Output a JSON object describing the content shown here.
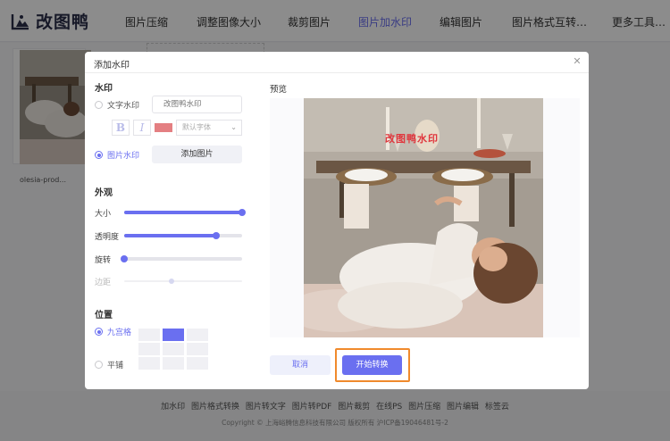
{
  "brand": {
    "name": "改图鸭"
  },
  "nav": {
    "items": [
      {
        "label": "图片压缩"
      },
      {
        "label": "调整图像大小"
      },
      {
        "label": "裁剪图片"
      },
      {
        "label": "图片加水印",
        "active": true
      },
      {
        "label": "编辑图片"
      },
      {
        "label": "图片格式互转…"
      },
      {
        "label": "更多工具…"
      }
    ]
  },
  "file": {
    "name": "olesia-prod..."
  },
  "footer": {
    "links": [
      "加水印",
      "图片格式转换",
      "图片转文字",
      "图片转PDF",
      "图片裁剪",
      "在线PS",
      "图片压缩",
      "图片编辑",
      "标签云"
    ],
    "copyright": "Copyright © 上海峪腾信息科技有限公司 版权所有 沪ICP备19046481号-2"
  },
  "modal": {
    "title": "添加水印",
    "watermark_section": {
      "title": "水印",
      "text_option": "文字水印",
      "text_placeholder": "改图鸭水印",
      "bold_label": "B",
      "italic_label": "I",
      "font_select": "默认字体",
      "image_option": "图片水印",
      "add_image_button": "添加图片",
      "selected": "image"
    },
    "appearance": {
      "title": "外观",
      "sliders": [
        {
          "label": "大小",
          "value": 100,
          "enabled": true
        },
        {
          "label": "透明度",
          "value": 78,
          "enabled": true
        },
        {
          "label": "旋转",
          "value": 0,
          "enabled": true
        },
        {
          "label": "边距",
          "value": 40,
          "enabled": false
        }
      ]
    },
    "position": {
      "title": "位置",
      "grid_option": "九宫格",
      "tile_option": "平铺",
      "selected": "grid",
      "selected_cell": 1
    },
    "preview": {
      "label": "预览",
      "watermark_text": "改图鸭水印"
    },
    "buttons": {
      "cancel": "取消",
      "start": "开始转换"
    }
  },
  "colors": {
    "accent": "#6a6ff0",
    "highlight": "#f08a2c",
    "watermark_text": "#e0363d",
    "swatch": "#e47f82"
  }
}
